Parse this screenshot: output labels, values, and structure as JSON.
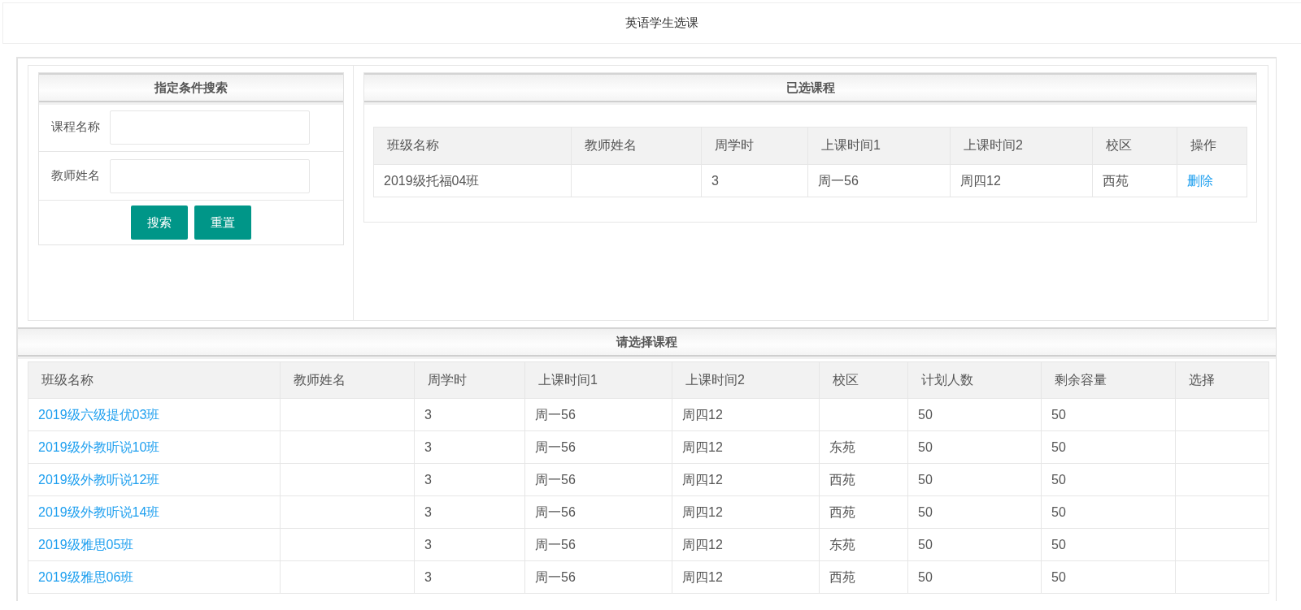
{
  "page_title": "英语学生选课",
  "search_panel": {
    "title": "指定条件搜索",
    "fields": [
      {
        "label": "课程名称"
      },
      {
        "label": "教师姓名"
      }
    ],
    "buttons": [
      "搜索",
      "重置"
    ]
  },
  "selected_courses": {
    "title": "已选课程",
    "columns": [
      "班级名称",
      "教师姓名",
      "周学时",
      "上课时间1",
      "上课时间2",
      "校区",
      "操作"
    ],
    "rows": [
      {
        "class_name": "2019级托福04班",
        "hours": "3",
        "time1": "周一56",
        "time2": "周四12",
        "campus": "西苑",
        "action": "删除"
      }
    ]
  },
  "available_courses": {
    "title": "请选择课程",
    "columns": [
      "班级名称",
      "教师姓名",
      "周学时",
      "上课时间1",
      "上课时间2",
      "校区",
      "计划人数",
      "剩余容量",
      "选择"
    ],
    "rows": [
      {
        "class_name": "2019级六级提优03班",
        "hours": "3",
        "time1": "周一56",
        "time2": "周四12",
        "campus": "",
        "planned": "50",
        "remaining": "50"
      },
      {
        "class_name": "2019级外教听说10班",
        "hours": "3",
        "time1": "周一56",
        "time2": "周四12",
        "campus": "东苑",
        "planned": "50",
        "remaining": "50"
      },
      {
        "class_name": "2019级外教听说12班",
        "hours": "3",
        "time1": "周一56",
        "time2": "周四12",
        "campus": "西苑",
        "planned": "50",
        "remaining": "50"
      },
      {
        "class_name": "2019级外教听说14班",
        "hours": "3",
        "time1": "周一56",
        "time2": "周四12",
        "campus": "西苑",
        "planned": "50",
        "remaining": "50"
      },
      {
        "class_name": "2019级雅思05班",
        "hours": "3",
        "time1": "周一56",
        "time2": "周四12",
        "campus": "东苑",
        "planned": "50",
        "remaining": "50"
      },
      {
        "class_name": "2019级雅思06班",
        "hours": "3",
        "time1": "周一56",
        "time2": "周四12",
        "campus": "西苑",
        "planned": "50",
        "remaining": "50"
      }
    ]
  }
}
